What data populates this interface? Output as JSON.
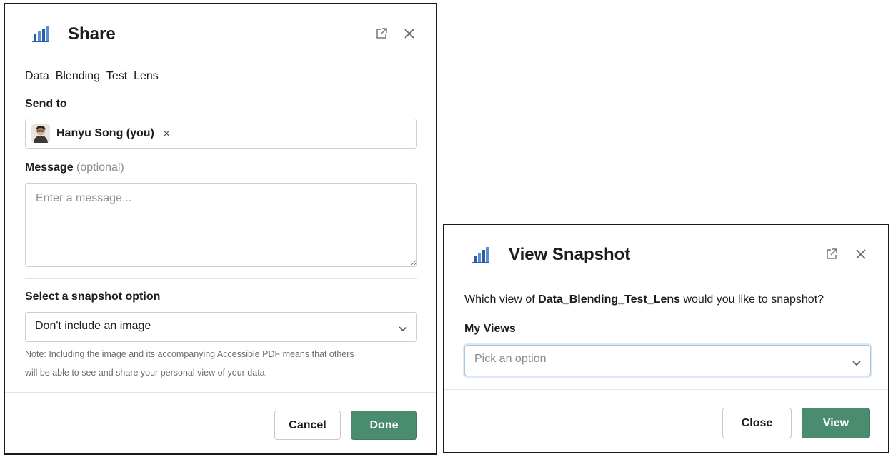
{
  "share_dialog": {
    "title": "Share",
    "icon": "bar-chart-icon",
    "header_icons": [
      "external-link-icon",
      "close-icon"
    ],
    "item_name": "Data_Blending_Test_Lens",
    "send_to_label": "Send to",
    "recipient": {
      "name": "Hanyu Song (you)",
      "remove": "×"
    },
    "message_label": "Message",
    "message_optional": "(optional)",
    "message_placeholder": "Enter a message...",
    "snapshot_label": "Select a snapshot option",
    "snapshot_value": "Don't include an image",
    "note_line1": "Note: Including the image and its accompanying Accessible PDF means that others",
    "note_line2": "will be able to see and share your personal view of your data.",
    "cancel": "Cancel",
    "done": "Done"
  },
  "snapshot_dialog": {
    "title": "View Snapshot",
    "icon": "bar-chart-icon",
    "header_icons": [
      "external-link-icon",
      "close-icon"
    ],
    "question_prefix": "Which view of ",
    "question_item": "Data_Blending_Test_Lens",
    "question_suffix": " would you like to snapshot?",
    "views_label": "My Views",
    "views_placeholder": "Pick an option",
    "close": "Close",
    "view": "View"
  },
  "colors": {
    "primary_button": "#4a8c6f",
    "icon_blue": "#2a5ca8"
  }
}
